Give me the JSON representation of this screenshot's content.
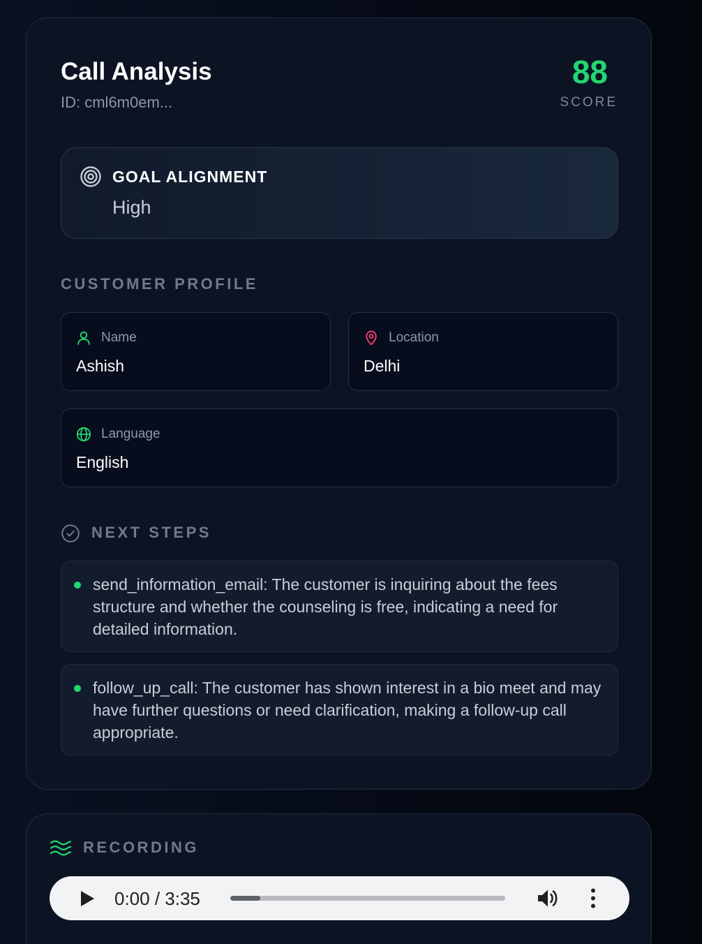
{
  "header": {
    "title": "Call Analysis",
    "id_text": "ID: cml6m0em...",
    "score_value": "88",
    "score_label": "SCORE"
  },
  "goal": {
    "title": "GOAL ALIGNMENT",
    "value": "High",
    "icon": "target-icon"
  },
  "profile": {
    "heading": "CUSTOMER PROFILE",
    "fields": [
      {
        "label": "Name",
        "value": "Ashish",
        "icon": "user-icon",
        "icon_color": "#22d770"
      },
      {
        "label": "Location",
        "value": "Delhi",
        "icon": "map-pin-icon",
        "icon_color": "#f43f6e"
      },
      {
        "label": "Language",
        "value": "English",
        "icon": "globe-icon",
        "icon_color": "#22d770"
      }
    ]
  },
  "next_steps": {
    "heading": "NEXT STEPS",
    "icon": "check-circle-icon",
    "items": [
      "send_information_email: The customer is inquiring about the fees structure and whether the counseling is free, indicating a need for detailed information.",
      "follow_up_call: The customer has shown interest in a bio meet and may have further questions or need clarification, making a follow-up call appropriate."
    ]
  },
  "recording": {
    "heading": "RECORDING",
    "icon": "waves-icon",
    "time": "0:00 / 3:35",
    "buffered_fraction": 0.11
  },
  "colors": {
    "accent_green": "#22d770",
    "accent_pink": "#f43f6e",
    "card_bg": "#0c1424"
  }
}
